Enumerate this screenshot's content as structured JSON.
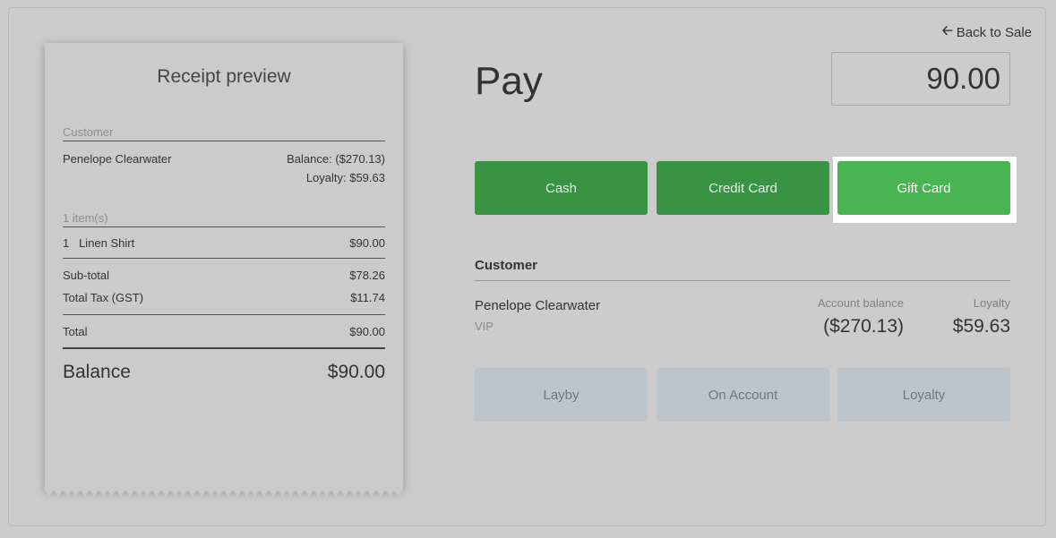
{
  "header": {
    "back_label": "Back to Sale"
  },
  "receipt": {
    "title": "Receipt preview",
    "customer_label": "Customer",
    "customer_name": "Penelope Clearwater",
    "balance_text": "Balance: ($270.13)",
    "loyalty_text": "Loyalty: $59.63",
    "items_label": "1 item(s)",
    "items": [
      {
        "qty": "1",
        "name": "Linen Shirt",
        "price": "$90.00"
      }
    ],
    "subtotal_label": "Sub-total",
    "subtotal_value": "$78.26",
    "tax_label": "Total Tax (GST)",
    "tax_value": "$11.74",
    "total_label": "Total",
    "total_value": "$90.00",
    "balance_label": "Balance",
    "balance_value": "$90.00"
  },
  "pay": {
    "title": "Pay",
    "amount": "90.00",
    "methods": [
      {
        "label": "Cash",
        "active": false
      },
      {
        "label": "Credit Card",
        "active": false
      },
      {
        "label": "Gift Card",
        "active": true
      }
    ]
  },
  "customer": {
    "heading": "Customer",
    "name": "Penelope Clearwater",
    "group": "VIP",
    "account_balance_label": "Account balance",
    "account_balance_value": "($270.13)",
    "loyalty_label": "Loyalty",
    "loyalty_value": "$59.63"
  },
  "secondary_methods": [
    "Layby",
    "On Account",
    "Loyalty"
  ],
  "colors": {
    "pay_button": "#389442",
    "pay_button_active": "#49b552",
    "secondary_button": "#bcc4cc"
  }
}
